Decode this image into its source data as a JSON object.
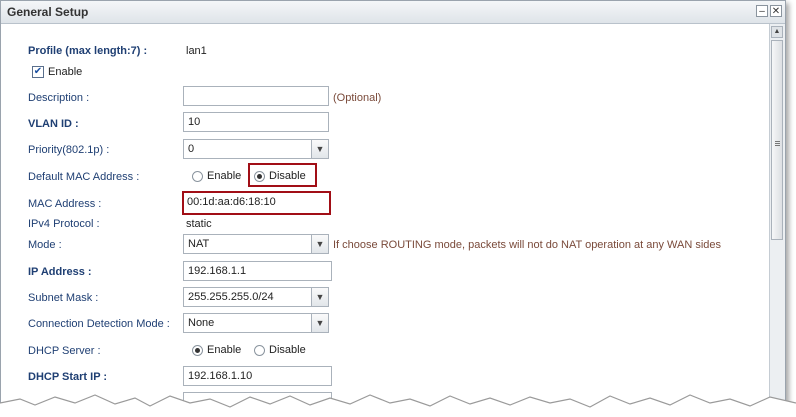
{
  "window": {
    "title": "General Setup",
    "minimize_glyph": "–",
    "close_glyph": "✕"
  },
  "form": {
    "profile": {
      "label": "Profile (max length:7) :",
      "value": "lan1"
    },
    "enable_checkbox": {
      "label": "Enable",
      "checked": true
    },
    "description": {
      "label": "Description :",
      "value": "",
      "note": "(Optional)"
    },
    "vlan_id": {
      "label": "VLAN ID :",
      "value": "10"
    },
    "priority": {
      "label": "Priority(802.1p) :",
      "value": "0"
    },
    "default_mac": {
      "label": "Default MAC Address :",
      "option_enable": "Enable",
      "option_disable": "Disable",
      "selected": "Disable"
    },
    "mac_address": {
      "label": "MAC Address :",
      "value": "00:1d:aa:d6:18:10"
    },
    "ipv4_protocol": {
      "label": "IPv4 Protocol :",
      "value": "static"
    },
    "mode": {
      "label": "Mode :",
      "value": "NAT",
      "note": "If choose ROUTING mode, packets will not do NAT operation at any WAN sides"
    },
    "ip_address": {
      "label": "IP Address :",
      "value": "192.168.1.1"
    },
    "subnet_mask": {
      "label": "Subnet Mask :",
      "value": "255.255.255.0/24"
    },
    "connection_detection": {
      "label": "Connection Detection Mode :",
      "value": "None"
    },
    "dhcp_server": {
      "label": "DHCP Server :",
      "option_enable": "Enable",
      "option_disable": "Disable",
      "selected": "Enable"
    },
    "dhcp_start_ip": {
      "label": "DHCP Start IP :",
      "value": "192.168.1.10"
    }
  },
  "icons": {
    "dropdown": "chevron-down-icon",
    "check": "checkmark-icon",
    "scroll_up": "arrow-up-icon"
  },
  "colors": {
    "label": "#1f3f73",
    "highlight_border": "#a10e16",
    "note": "#7a4a3a"
  }
}
